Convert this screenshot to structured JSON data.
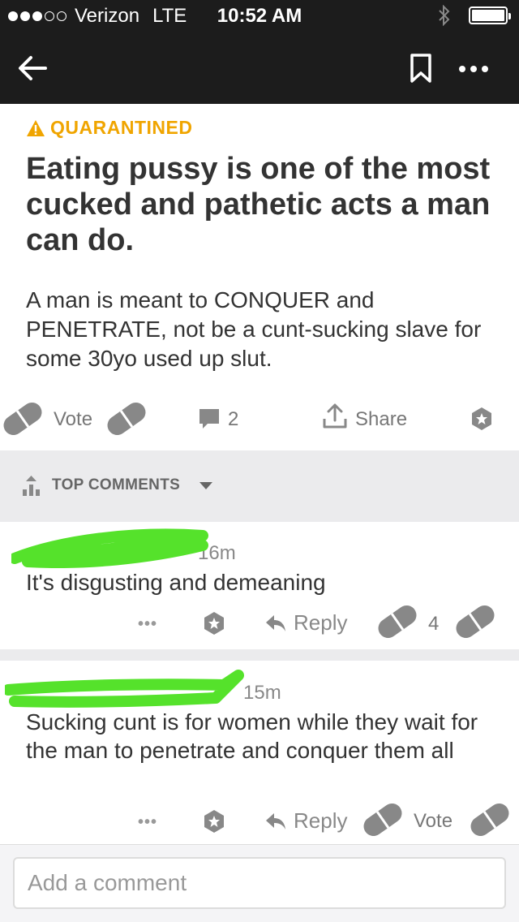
{
  "status_bar": {
    "carrier": "Verizon",
    "network": "LTE",
    "time": "10:52 AM"
  },
  "post": {
    "badge": "QUARANTINED",
    "title": "Eating pussy is one of the most cucked and pathetic acts a man can do.",
    "body": "A man is meant to CONQUER and PENETRATE, not be a cunt-sucking slave for some 30yo used up slut.",
    "vote_label": "Vote",
    "comment_count": "2",
    "share_label": "Share"
  },
  "comments_header": {
    "label": "TOP COMMENTS"
  },
  "comments": [
    {
      "age": "16m",
      "text": "It's disgusting and demeaning",
      "reply_label": "Reply",
      "score": "4"
    },
    {
      "age": "15m",
      "text": "Sucking cunt is for women while they wait for the man to penetrate and conquer them all",
      "reply_label": "Reply",
      "vote_label": "Vote"
    }
  ],
  "composer": {
    "placeholder": "Add a comment"
  },
  "colors": {
    "dark_bar": "#1c1c1c",
    "quarantine": "#f0a500",
    "band": "#ebebed",
    "scribble": "#55e22b",
    "icon_gray": "#888888"
  }
}
